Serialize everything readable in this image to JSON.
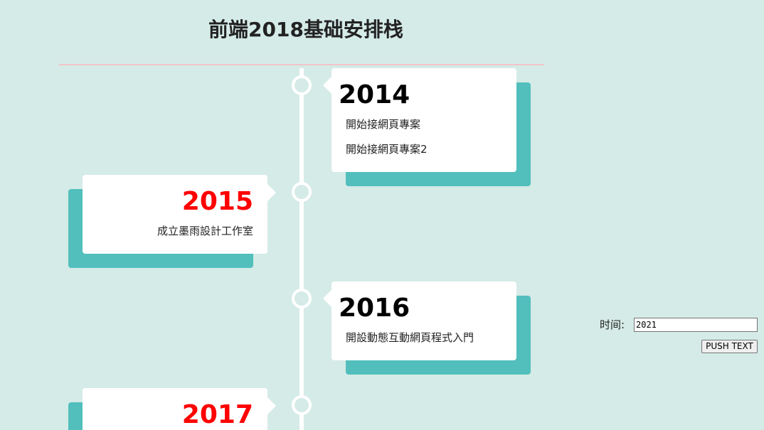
{
  "header": {
    "title": "前端2018基础安排栈"
  },
  "timeline": [
    {
      "year": "2014",
      "side": "right",
      "entries": [
        "開始接網頁專案",
        "開始接網頁專案2"
      ]
    },
    {
      "year": "2015",
      "side": "left",
      "entries": [
        "成立墨雨設計工作室"
      ]
    },
    {
      "year": "2016",
      "side": "right",
      "entries": [
        "開設動態互動網頁程式入門"
      ]
    },
    {
      "year": "2017",
      "side": "left",
      "entries": []
    }
  ],
  "form": {
    "time_label": "时间:",
    "time_value": "2021",
    "push_label": "PUSH TEXT"
  },
  "colors": {
    "background": "#d5ebe7",
    "card_shadow": "#52bfbd",
    "left_year": "#ff0000",
    "right_year": "#000000",
    "divider": "#f2c4c9"
  }
}
